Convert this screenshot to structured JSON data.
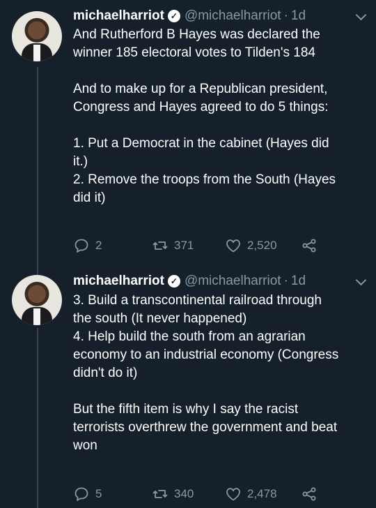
{
  "tweets": [
    {
      "name": "michaelharriot",
      "handle": "@michaelharriot",
      "separator": "·",
      "time": "1d",
      "paragraphs": [
        [
          "And Rutherford B Hayes was declared the",
          "winner 185 electoral votes to Tilden's 184"
        ],
        [
          "And to make up for a Republican president,",
          "Congress and Hayes agreed to do 5 things:"
        ],
        [
          "1. Put a Democrat in the cabinet (Hayes did",
          "it.)",
          "2. Remove the troops from the South (Hayes",
          "did it)"
        ]
      ],
      "stats": {
        "replies": "2",
        "retweets": "371",
        "likes": "2,520"
      }
    },
    {
      "name": "michaelharriot",
      "handle": "@michaelharriot",
      "separator": "·",
      "time": "1d",
      "paragraphs": [
        [
          "3. Build a transcontinental railroad through",
          "the south (It never happened)",
          "4. Help build the south from an agrarian",
          "economy to an industrial economy (Congress",
          "didn't do it)"
        ],
        [
          "But the fifth item is why I say the racist",
          "terrorists overthrew the government and beat",
          "won"
        ]
      ],
      "stats": {
        "replies": "5",
        "retweets": "340",
        "likes": "2,478"
      }
    }
  ],
  "icons": {
    "verified": "verified-badge-icon",
    "menu": "chevron-down-icon",
    "reply": "reply-icon",
    "retweet": "retweet-icon",
    "like": "heart-icon",
    "share": "share-icon"
  },
  "colors": {
    "background": "#15202b",
    "text": "#ffffff",
    "muted": "#8899a6",
    "thread_line": "#38444d"
  }
}
